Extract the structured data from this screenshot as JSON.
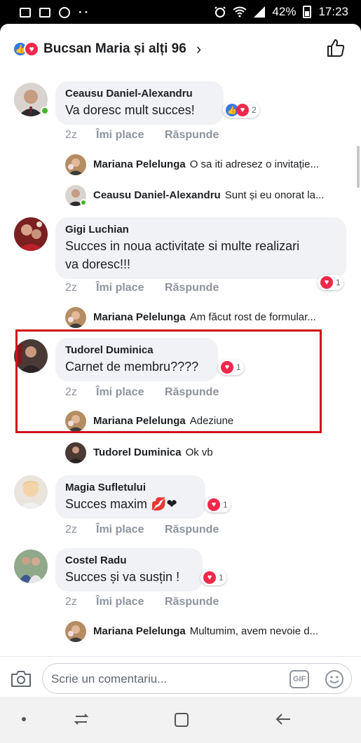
{
  "status_bar": {
    "battery": "42%",
    "time": "17:23"
  },
  "header": {
    "title": "Bucsan Maria și alți 96"
  },
  "comments": [
    {
      "name": "Ceausu Daniel-Alexandru",
      "text": "Va doresc mult succes!",
      "time": "2z",
      "like": "Îmi place",
      "reply": "Răspunde",
      "reaction_count": "2",
      "replies": [
        {
          "name": "Mariana Pelelunga",
          "text": "O sa iti adresez o invitație..."
        },
        {
          "name": "Ceausu Daniel-Alexandru",
          "text": "Sunt și eu onorat la..."
        }
      ]
    },
    {
      "name": "Gigi Luchian",
      "text_line1": "Succes in noua activitate si multe realizari",
      "text_line2": "va doresc!!!",
      "time": "2z",
      "like": "Îmi place",
      "reply": "Răspunde",
      "reaction_count": "1",
      "replies": [
        {
          "name": "Mariana Pelelunga",
          "text": "Am făcut rost de formular..."
        }
      ]
    },
    {
      "name": "Tudorel Duminica",
      "text": "Carnet de membru????",
      "time": "2z",
      "like": "Îmi place",
      "reply": "Răspunde",
      "reaction_count": "1",
      "replies": [
        {
          "name": "Mariana Pelelunga",
          "text": "Adeziune"
        },
        {
          "name": "Tudorel Duminica",
          "text": "Ok vb"
        }
      ]
    },
    {
      "name": "Magia Sufletului",
      "text": "Succes maxim 💋❤",
      "time": "2z",
      "like": "Îmi place",
      "reply": "Răspunde",
      "reaction_count": "1"
    },
    {
      "name": "Costel Radu",
      "text": "Succes și va susțin !",
      "time": "2z",
      "like": "Îmi place",
      "reply": "Răspunde",
      "reaction_count": "1",
      "replies": [
        {
          "name": "Mariana Pelelunga",
          "text": "Multumim, avem nevoie d..."
        }
      ]
    }
  ],
  "composer": {
    "placeholder": "Scrie un comentariu...",
    "gif_label": "GIF"
  },
  "colors": {
    "like_blue": "#3578e5",
    "love_red": "#f0284a",
    "highlight_red": "#d0101b",
    "bubble_gray": "#f0f2f5"
  }
}
